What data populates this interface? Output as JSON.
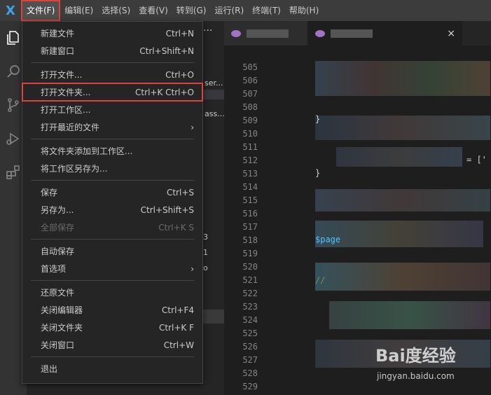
{
  "menubar": {
    "logo": "X",
    "items": [
      "文件(F)",
      "编辑(E)",
      "选择(S)",
      "查看(V)",
      "转到(G)",
      "运行(R)",
      "终端(T)",
      "帮助(H)"
    ]
  },
  "activitybar": {
    "icons": [
      "explorer-icon",
      "search-icon",
      "source-control-icon",
      "run-debug-icon",
      "extensions-icon"
    ]
  },
  "sidebar": {
    "fragments": [
      "ser...",
      "ass....",
      "3",
      "1",
      "o"
    ],
    "more_icon": "···"
  },
  "tabs": [
    {
      "icon": "php-icon",
      "label": ""
    },
    {
      "icon": "php-icon",
      "label": "",
      "close": "×"
    }
  ],
  "editor": {
    "line_numbers": [
      "505",
      "506",
      "507",
      "508",
      "509",
      "510",
      "511",
      "512",
      "513",
      "514",
      "515",
      "516",
      "517",
      "518",
      "519",
      "520",
      "521",
      "522",
      "523",
      "524",
      "525",
      "526",
      "527",
      "528",
      "529"
    ],
    "code_fragments": [
      "}",
      "= ['",
      "}",
      "$page",
      "//"
    ]
  },
  "file_menu": {
    "groups": [
      [
        {
          "label": "新建文件",
          "shortcut": "Ctrl+N"
        },
        {
          "label": "新建窗口",
          "shortcut": "Ctrl+Shift+N"
        }
      ],
      [
        {
          "label": "打开文件...",
          "shortcut": "Ctrl+O"
        },
        {
          "label": "打开文件夹...",
          "shortcut": "Ctrl+K Ctrl+O",
          "highlighted": true
        },
        {
          "label": "打开工作区...",
          "shortcut": ""
        },
        {
          "label": "打开最近的文件",
          "shortcut": "",
          "submenu": "›"
        }
      ],
      [
        {
          "label": "将文件夹添加到工作区...",
          "shortcut": ""
        },
        {
          "label": "将工作区另存为...",
          "shortcut": ""
        }
      ],
      [
        {
          "label": "保存",
          "shortcut": "Ctrl+S"
        },
        {
          "label": "另存为...",
          "shortcut": "Ctrl+Shift+S"
        },
        {
          "label": "全部保存",
          "shortcut": "Ctrl+K S",
          "disabled": true
        }
      ],
      [
        {
          "label": "自动保存",
          "shortcut": ""
        },
        {
          "label": "首选项",
          "shortcut": "",
          "submenu": "›"
        }
      ],
      [
        {
          "label": "还原文件",
          "shortcut": ""
        },
        {
          "label": "关闭编辑器",
          "shortcut": "Ctrl+F4"
        },
        {
          "label": "关闭文件夹",
          "shortcut": "Ctrl+K F"
        },
        {
          "label": "关闭窗口",
          "shortcut": "Ctrl+W"
        }
      ],
      [
        {
          "label": "退出",
          "shortcut": ""
        }
      ]
    ]
  },
  "watermark": {
    "logo": "Bai度经验",
    "url": "jingyan.baidu.com"
  },
  "colors": {
    "menubar_bg": "#3c3c3c",
    "menu_bg": "#252526",
    "editor_bg": "#1e1e1e",
    "highlight_border": "#e0423a",
    "vscode_blue": "#3da4e8"
  }
}
